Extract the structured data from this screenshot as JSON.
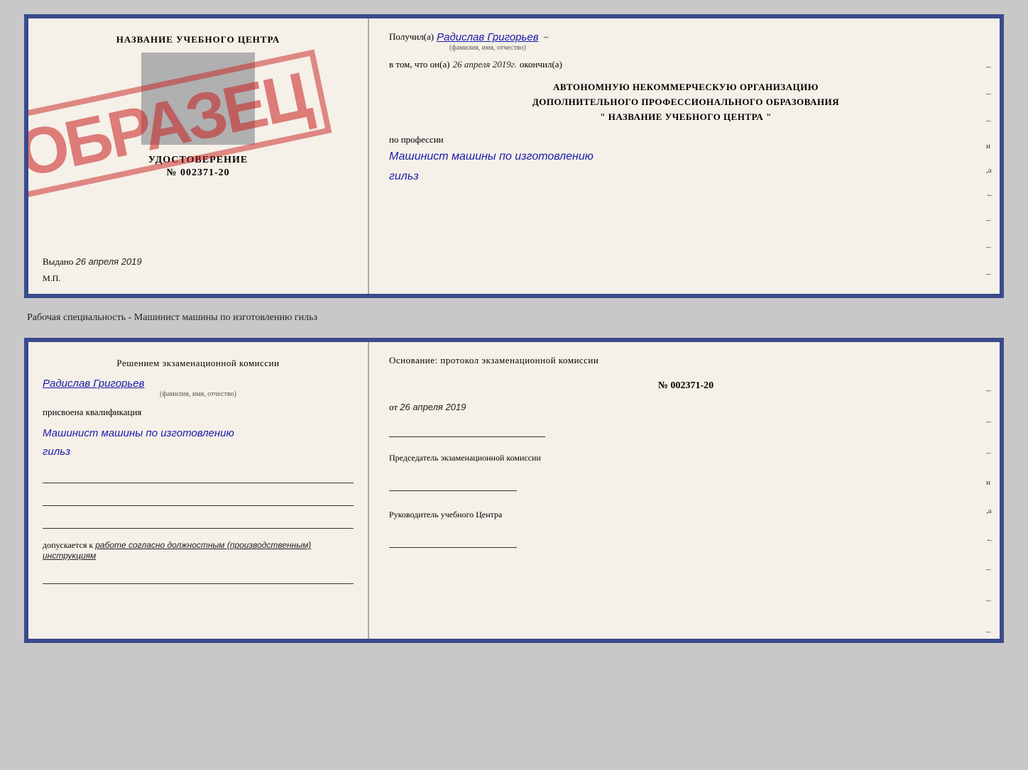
{
  "top_doc": {
    "left": {
      "title": "НАЗВАНИЕ УЧЕБНОГО ЦЕНТРА",
      "cert_label": "УДОСТОВЕРЕНИЕ",
      "cert_number": "№ 002371-20",
      "issued_label": "Выдано",
      "issued_date": "26 апреля 2019",
      "mp_label": "М.П.",
      "stamp_text": "ОБРАЗЕЦ"
    },
    "right": {
      "received_label": "Получил(а)",
      "recipient_name": "Радислав Григорьев",
      "fio_sub": "(фамилия, имя, отчество)",
      "in_that_label": "в том, что он(а)",
      "completion_date": "26 апреля 2019г.",
      "completed_label": "окончил(а)",
      "org_line1": "АВТОНОМНУЮ НЕКОММЕРЧЕСКУЮ ОРГАНИЗАЦИЮ",
      "org_line2": "ДОПОЛНИТЕЛЬНОГО ПРОФЕССИОНАЛЬНОГО ОБРАЗОВАНИЯ",
      "org_name": "\"  НАЗВАНИЕ УЧЕБНОГО ЦЕНТРА  \"",
      "profession_label": "по профессии",
      "profession_text": "Машинист машины по изготовлению",
      "profession_text2": "гильз"
    }
  },
  "caption": "Рабочая специальность - Машинист машины по изготовлению гильз",
  "bottom_doc": {
    "left": {
      "title": "Решением экзаменационной комиссии",
      "name": "Радислав Григорьев",
      "fio_sub": "(фамилия, имя, отчество)",
      "assigned_label": "присвоена квалификация",
      "profession": "Машинист машины по изготовлению",
      "profession2": "гильз",
      "допуск_label": "допускается к",
      "допуск_text": "работе согласно должностным (производственным) инструкциям"
    },
    "right": {
      "basis_label": "Основание: протокол экзаменационной комиссии",
      "protocol_number": "№ 002371-20",
      "date_label": "от",
      "protocol_date": "26 апреля 2019",
      "chairman_title": "Председатель экзаменационной комиссии",
      "head_title": "Руководитель учебного Центра"
    }
  }
}
